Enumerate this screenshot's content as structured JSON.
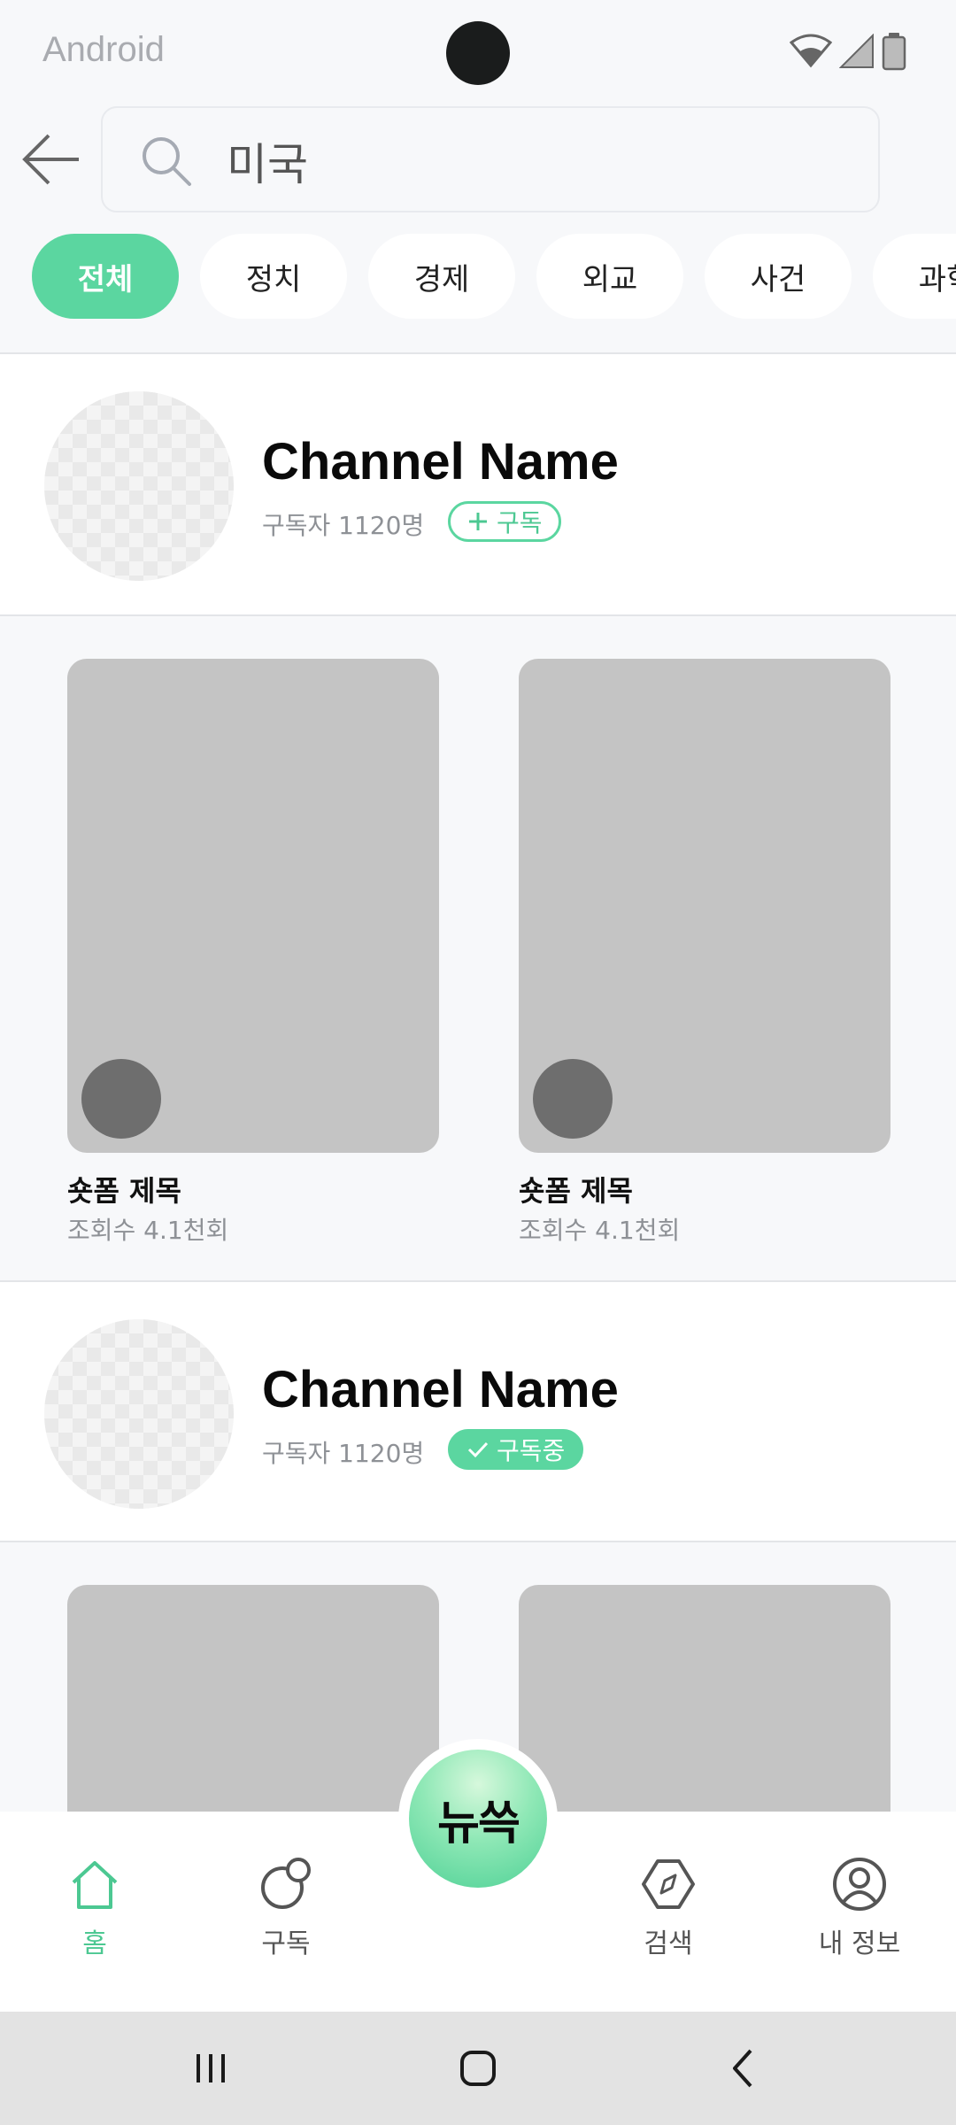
{
  "status_bar": {
    "carrier": "Android"
  },
  "search": {
    "value": "미국"
  },
  "categories": [
    {
      "label": "전체",
      "active": true
    },
    {
      "label": "정치",
      "active": false
    },
    {
      "label": "경제",
      "active": false
    },
    {
      "label": "외교",
      "active": false
    },
    {
      "label": "사건",
      "active": false
    },
    {
      "label": "과학",
      "active": false
    }
  ],
  "channels": [
    {
      "name": "Channel Name",
      "subscribers": "구독자 1120명",
      "subscribe_label": "구독",
      "subscribed": false,
      "shorts": [
        {
          "title": "숏폼 제목",
          "views": "조회수 4.1천회"
        },
        {
          "title": "숏폼 제목",
          "views": "조회수 4.1천회"
        }
      ]
    },
    {
      "name": "Channel Name",
      "subscribers": "구독자 1120명",
      "subscribe_label": "구독중",
      "subscribed": true,
      "shorts": [
        {
          "title": "",
          "views": ""
        },
        {
          "title": "",
          "views": ""
        }
      ]
    }
  ],
  "bottom_nav": {
    "home": "홈",
    "subscriptions": "구독",
    "center_label": "뉴쓱",
    "search": "검색",
    "profile": "내 정보"
  },
  "colors": {
    "accent": "#5bd6a0",
    "thumbnail": "#c4c4c4",
    "background": "#f7f8fa"
  }
}
